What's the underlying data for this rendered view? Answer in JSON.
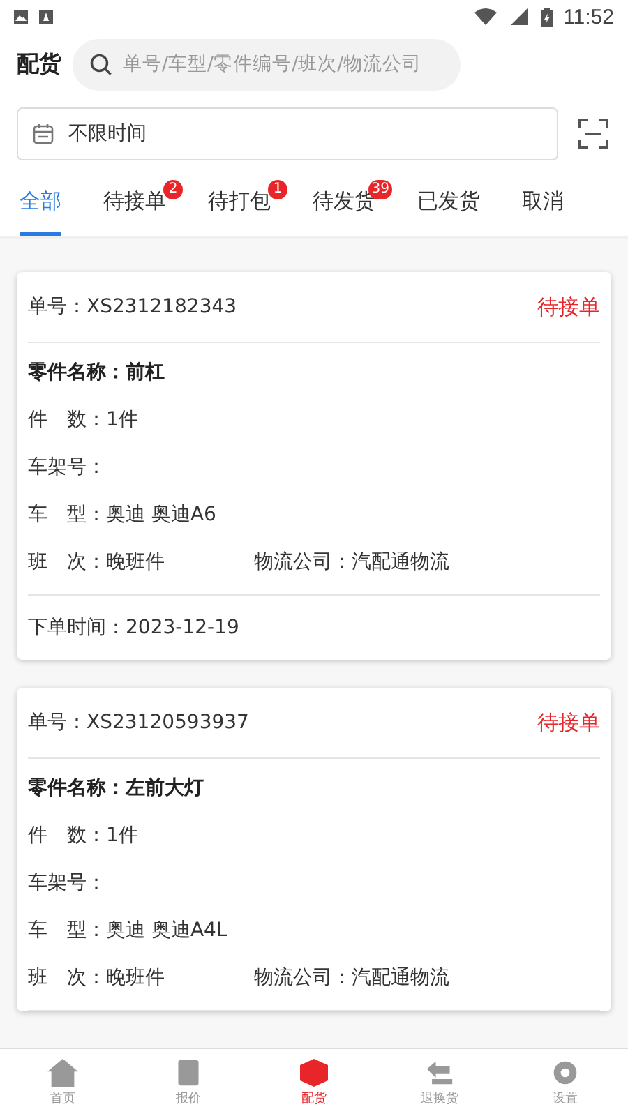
{
  "status_bar": {
    "time": "11:52"
  },
  "header": {
    "title": "配货",
    "search": {
      "placeholder": "单号/车型/零件编号/班次/物流公司"
    }
  },
  "date_filter": {
    "value": "不限时间"
  },
  "tabs": [
    {
      "label": "全部",
      "selected": true
    },
    {
      "label": "待接单",
      "selected": false,
      "badge": "2"
    },
    {
      "label": "待打包",
      "selected": false,
      "badge": "1"
    },
    {
      "label": "待发货",
      "selected": false,
      "badge": "39"
    },
    {
      "label": "已发货",
      "selected": false
    },
    {
      "label": "取消",
      "selected": false
    }
  ],
  "orders": [
    {
      "order_no_label": "单号：",
      "order_no": "XS2312182343",
      "status": "待接单",
      "part_label": "零件名称：",
      "part": "前杠",
      "qty_label": "件　数：",
      "qty": "1件",
      "vin_label": "车架号：",
      "model_label": "车　型：",
      "model": "奥迪 奥迪A6",
      "shift_label": "班　次：",
      "shift": "晚班件",
      "logistics_label": "物流公司：",
      "logistics": "汽配通物流",
      "time_label": "下单时间：",
      "time": "2023-12-19"
    },
    {
      "order_no_label": "单号：",
      "order_no": "XS23120593937",
      "status": "待接单",
      "part_label": "零件名称：",
      "part": "左前大灯",
      "qty_label": "件　数：",
      "qty": "1件",
      "vin_label": "车架号：",
      "model_label": "车　型：",
      "model": "奥迪 奥迪A4L",
      "shift_label": "班　次：",
      "shift": "晚班件",
      "logistics_label": "物流公司：",
      "logistics": "汽配通物流"
    }
  ],
  "bottom_nav": [
    {
      "label": "首页",
      "selected": false
    },
    {
      "label": "报价",
      "selected": false
    },
    {
      "label": "配货",
      "selected": true
    },
    {
      "label": "退换货",
      "selected": false
    },
    {
      "label": "设置",
      "selected": false
    }
  ]
}
